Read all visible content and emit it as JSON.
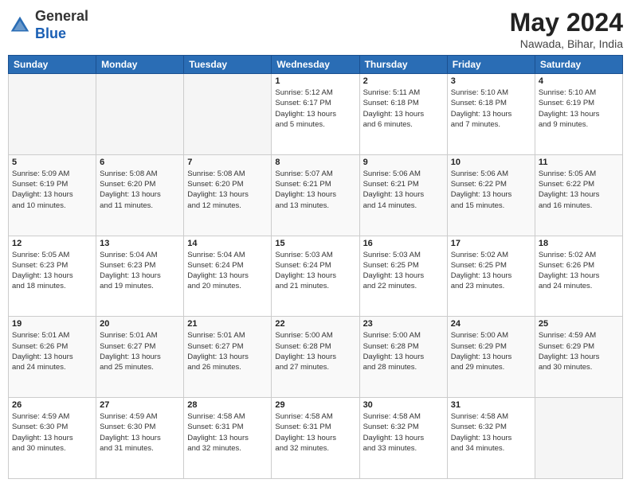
{
  "header": {
    "logo_line1": "General",
    "logo_line2": "Blue",
    "month_year": "May 2024",
    "location": "Nawada, Bihar, India"
  },
  "days_of_week": [
    "Sunday",
    "Monday",
    "Tuesday",
    "Wednesday",
    "Thursday",
    "Friday",
    "Saturday"
  ],
  "weeks": [
    [
      {
        "day": "",
        "info": "",
        "empty": true
      },
      {
        "day": "",
        "info": "",
        "empty": true
      },
      {
        "day": "",
        "info": "",
        "empty": true
      },
      {
        "day": "1",
        "sunrise": "Sunrise: 5:12 AM",
        "sunset": "Sunset: 6:17 PM",
        "daylight": "Daylight: 13 hours and 5 minutes."
      },
      {
        "day": "2",
        "sunrise": "Sunrise: 5:11 AM",
        "sunset": "Sunset: 6:18 PM",
        "daylight": "Daylight: 13 hours and 6 minutes."
      },
      {
        "day": "3",
        "sunrise": "Sunrise: 5:10 AM",
        "sunset": "Sunset: 6:18 PM",
        "daylight": "Daylight: 13 hours and 7 minutes."
      },
      {
        "day": "4",
        "sunrise": "Sunrise: 5:10 AM",
        "sunset": "Sunset: 6:19 PM",
        "daylight": "Daylight: 13 hours and 9 minutes."
      }
    ],
    [
      {
        "day": "5",
        "sunrise": "Sunrise: 5:09 AM",
        "sunset": "Sunset: 6:19 PM",
        "daylight": "Daylight: 13 hours and 10 minutes."
      },
      {
        "day": "6",
        "sunrise": "Sunrise: 5:08 AM",
        "sunset": "Sunset: 6:20 PM",
        "daylight": "Daylight: 13 hours and 11 minutes."
      },
      {
        "day": "7",
        "sunrise": "Sunrise: 5:08 AM",
        "sunset": "Sunset: 6:20 PM",
        "daylight": "Daylight: 13 hours and 12 minutes."
      },
      {
        "day": "8",
        "sunrise": "Sunrise: 5:07 AM",
        "sunset": "Sunset: 6:21 PM",
        "daylight": "Daylight: 13 hours and 13 minutes."
      },
      {
        "day": "9",
        "sunrise": "Sunrise: 5:06 AM",
        "sunset": "Sunset: 6:21 PM",
        "daylight": "Daylight: 13 hours and 14 minutes."
      },
      {
        "day": "10",
        "sunrise": "Sunrise: 5:06 AM",
        "sunset": "Sunset: 6:22 PM",
        "daylight": "Daylight: 13 hours and 15 minutes."
      },
      {
        "day": "11",
        "sunrise": "Sunrise: 5:05 AM",
        "sunset": "Sunset: 6:22 PM",
        "daylight": "Daylight: 13 hours and 16 minutes."
      }
    ],
    [
      {
        "day": "12",
        "sunrise": "Sunrise: 5:05 AM",
        "sunset": "Sunset: 6:23 PM",
        "daylight": "Daylight: 13 hours and 18 minutes."
      },
      {
        "day": "13",
        "sunrise": "Sunrise: 5:04 AM",
        "sunset": "Sunset: 6:23 PM",
        "daylight": "Daylight: 13 hours and 19 minutes."
      },
      {
        "day": "14",
        "sunrise": "Sunrise: 5:04 AM",
        "sunset": "Sunset: 6:24 PM",
        "daylight": "Daylight: 13 hours and 20 minutes."
      },
      {
        "day": "15",
        "sunrise": "Sunrise: 5:03 AM",
        "sunset": "Sunset: 6:24 PM",
        "daylight": "Daylight: 13 hours and 21 minutes."
      },
      {
        "day": "16",
        "sunrise": "Sunrise: 5:03 AM",
        "sunset": "Sunset: 6:25 PM",
        "daylight": "Daylight: 13 hours and 22 minutes."
      },
      {
        "day": "17",
        "sunrise": "Sunrise: 5:02 AM",
        "sunset": "Sunset: 6:25 PM",
        "daylight": "Daylight: 13 hours and 23 minutes."
      },
      {
        "day": "18",
        "sunrise": "Sunrise: 5:02 AM",
        "sunset": "Sunset: 6:26 PM",
        "daylight": "Daylight: 13 hours and 24 minutes."
      }
    ],
    [
      {
        "day": "19",
        "sunrise": "Sunrise: 5:01 AM",
        "sunset": "Sunset: 6:26 PM",
        "daylight": "Daylight: 13 hours and 24 minutes."
      },
      {
        "day": "20",
        "sunrise": "Sunrise: 5:01 AM",
        "sunset": "Sunset: 6:27 PM",
        "daylight": "Daylight: 13 hours and 25 minutes."
      },
      {
        "day": "21",
        "sunrise": "Sunrise: 5:01 AM",
        "sunset": "Sunset: 6:27 PM",
        "daylight": "Daylight: 13 hours and 26 minutes."
      },
      {
        "day": "22",
        "sunrise": "Sunrise: 5:00 AM",
        "sunset": "Sunset: 6:28 PM",
        "daylight": "Daylight: 13 hours and 27 minutes."
      },
      {
        "day": "23",
        "sunrise": "Sunrise: 5:00 AM",
        "sunset": "Sunset: 6:28 PM",
        "daylight": "Daylight: 13 hours and 28 minutes."
      },
      {
        "day": "24",
        "sunrise": "Sunrise: 5:00 AM",
        "sunset": "Sunset: 6:29 PM",
        "daylight": "Daylight: 13 hours and 29 minutes."
      },
      {
        "day": "25",
        "sunrise": "Sunrise: 4:59 AM",
        "sunset": "Sunset: 6:29 PM",
        "daylight": "Daylight: 13 hours and 30 minutes."
      }
    ],
    [
      {
        "day": "26",
        "sunrise": "Sunrise: 4:59 AM",
        "sunset": "Sunset: 6:30 PM",
        "daylight": "Daylight: 13 hours and 30 minutes."
      },
      {
        "day": "27",
        "sunrise": "Sunrise: 4:59 AM",
        "sunset": "Sunset: 6:30 PM",
        "daylight": "Daylight: 13 hours and 31 minutes."
      },
      {
        "day": "28",
        "sunrise": "Sunrise: 4:58 AM",
        "sunset": "Sunset: 6:31 PM",
        "daylight": "Daylight: 13 hours and 32 minutes."
      },
      {
        "day": "29",
        "sunrise": "Sunrise: 4:58 AM",
        "sunset": "Sunset: 6:31 PM",
        "daylight": "Daylight: 13 hours and 32 minutes."
      },
      {
        "day": "30",
        "sunrise": "Sunrise: 4:58 AM",
        "sunset": "Sunset: 6:32 PM",
        "daylight": "Daylight: 13 hours and 33 minutes."
      },
      {
        "day": "31",
        "sunrise": "Sunrise: 4:58 AM",
        "sunset": "Sunset: 6:32 PM",
        "daylight": "Daylight: 13 hours and 34 minutes."
      },
      {
        "day": "",
        "info": "",
        "empty": true
      }
    ]
  ]
}
